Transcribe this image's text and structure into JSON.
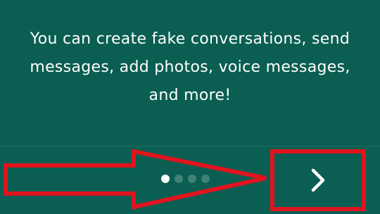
{
  "onboarding": {
    "message": "You can create fake conversations, send messages, add photos, voice messages, and more!",
    "page_indicator": {
      "total_pages": 4,
      "current_page": 1
    },
    "next_button": {
      "icon": "chevron-right-icon"
    }
  },
  "annotation": {
    "color": "#e0141e",
    "shape": "arrow-pointing-right"
  },
  "colors": {
    "background": "#0b5e52",
    "text": "#ffffff",
    "dot_active": "#ffffff",
    "dot_inactive": "#3f8277"
  }
}
